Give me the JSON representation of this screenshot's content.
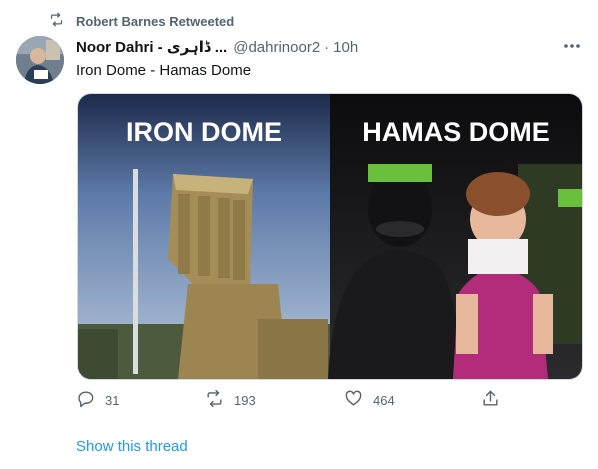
{
  "retweet": {
    "label": "Robert Barnes Retweeted",
    "icon": "retweet-icon"
  },
  "tweet": {
    "display_name": "Noor Dahri - ڈاہری ...",
    "handle": "@dahrinoor2",
    "separator": "·",
    "time": "10h",
    "text": "Iron Dome - Hamas Dome",
    "more_icon": "more-icon"
  },
  "media": {
    "left_caption": "IRON DOME",
    "right_caption": "HAMAS DOME"
  },
  "actions": {
    "reply": {
      "icon": "reply-icon",
      "count": "31"
    },
    "retweet": {
      "icon": "retweet-icon",
      "count": "193"
    },
    "like": {
      "icon": "like-icon",
      "count": "464"
    },
    "share": {
      "icon": "share-icon"
    }
  },
  "show_thread": "Show this thread",
  "colors": {
    "accent": "#1d9bf0",
    "muted": "#536471",
    "text": "#0f1419",
    "headband": "#6abf3c"
  }
}
